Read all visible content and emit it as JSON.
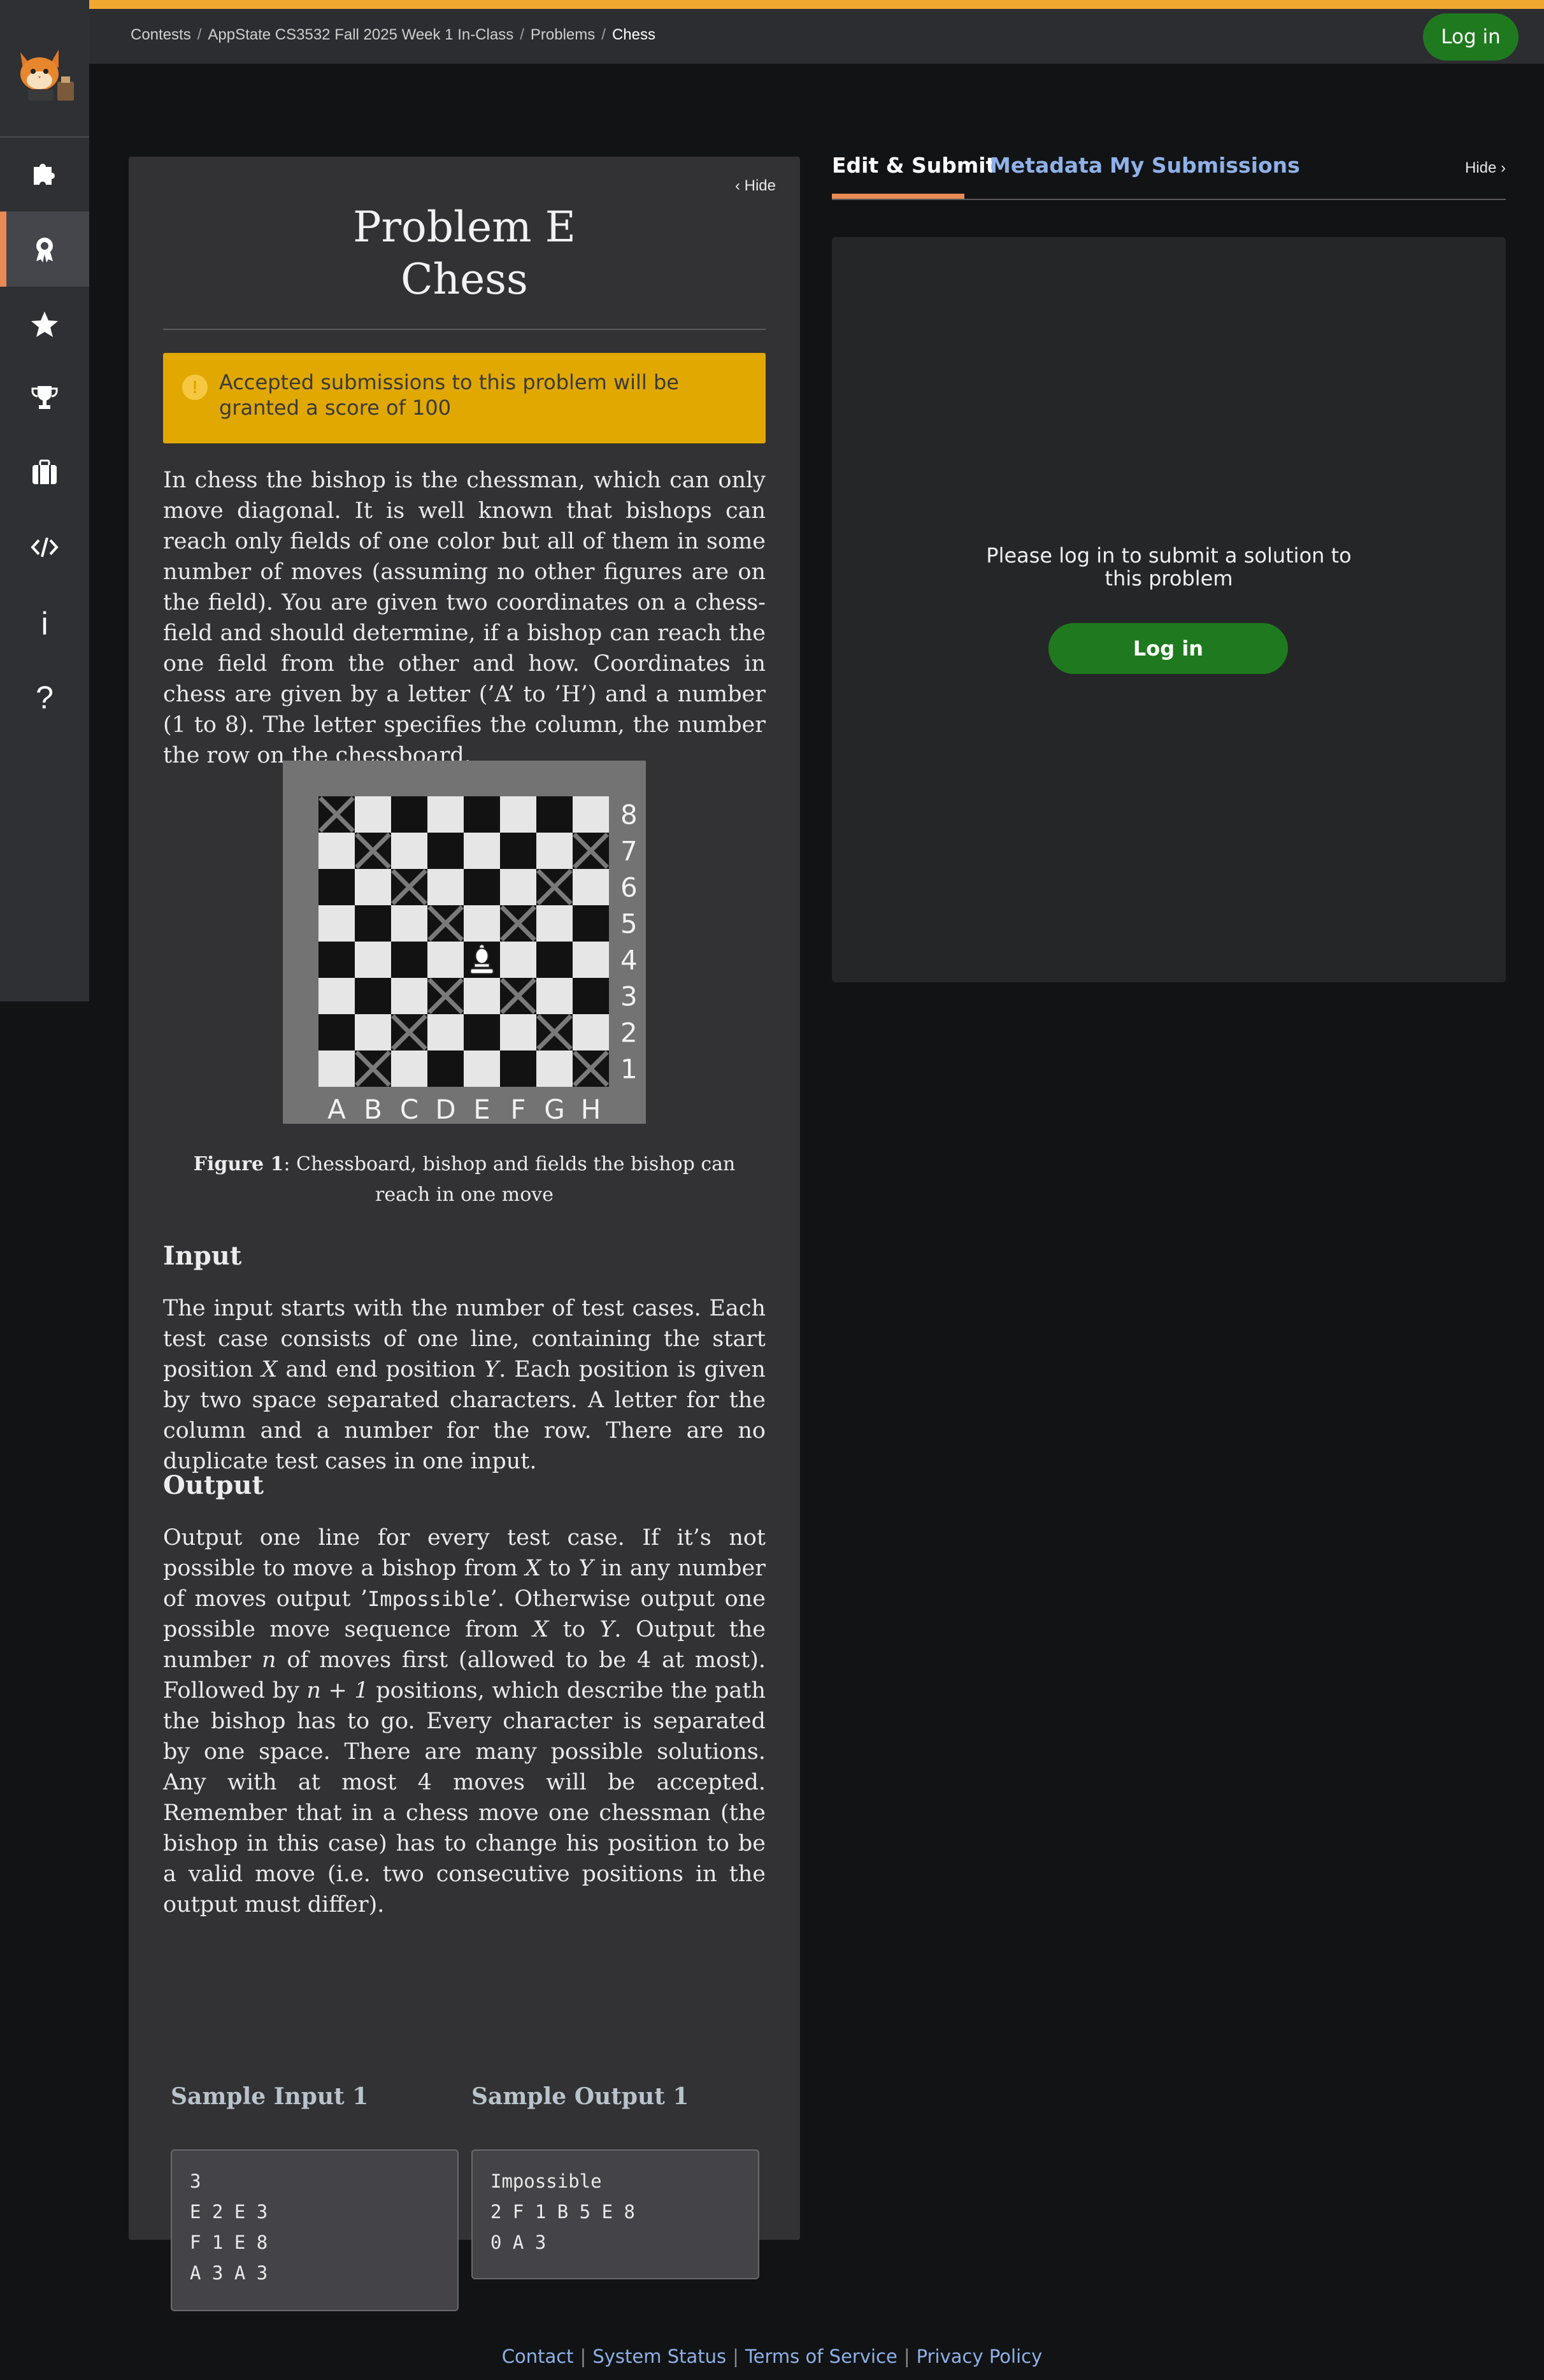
{
  "breadcrumb": {
    "items": [
      "Contests",
      "AppState CS3532 Fall 2025 Week 1 In-Class",
      "Problems"
    ],
    "current": "Chess"
  },
  "header": {
    "login_label": "Log in"
  },
  "sidebar": {
    "items": [
      {
        "icon": "puzzle-icon"
      },
      {
        "icon": "award-icon",
        "active": true
      },
      {
        "icon": "star-icon"
      },
      {
        "icon": "trophy-icon"
      },
      {
        "icon": "briefcase-icon"
      },
      {
        "icon": "code-icon"
      },
      {
        "icon": "info-icon",
        "label": "i"
      },
      {
        "icon": "help-icon",
        "label": "?"
      }
    ]
  },
  "problem": {
    "hide_label": "Hide",
    "title_line1": "Problem E",
    "title_line2": "Chess",
    "alert": "Accepted submissions to this problem will be granted a score of 100",
    "intro": "In chess the bishop is the chessman, which can only move diagonal. It is well known that bishops can reach only fields of one color but all of them in some number of moves (assuming no other figures are on the field). You are given two coordinates on a chess-field and should determine, if a bishop can reach the one field from the other and how. Coordinates in chess are given by a letter (’A’ to ’H’) and a number (1 to 8). The letter specifies the column, the number the row on the chessboard.",
    "figure": {
      "files": [
        "A",
        "B",
        "C",
        "D",
        "E",
        "F",
        "G",
        "H"
      ],
      "ranks": [
        "8",
        "7",
        "6",
        "5",
        "4",
        "3",
        "2",
        "1"
      ],
      "bishop": "E4",
      "marked": [
        "A8",
        "B7",
        "H7",
        "C6",
        "G6",
        "D5",
        "F5",
        "D3",
        "F3",
        "C2",
        "G2",
        "B1",
        "H1"
      ],
      "caption_label": "Figure 1",
      "caption_text": ": Chessboard, bishop and fields the bishop can reach in one move"
    },
    "input_heading": "Input",
    "input_parts": {
      "a": "The input starts with the number of test cases. Each test case consists of one line, containing the start position ",
      "var_x": "X",
      "b": " and end position ",
      "var_y": "Y",
      "c": ". Each position is given by two space separated characters. A letter for the column and a number for the row. There are no duplicate test cases in one input."
    },
    "output_heading": "Output",
    "output_parts": {
      "a": "Output one line for every test case. If it’s not possible to move a bishop from ",
      "x1": "X",
      "b": " to ",
      "y1": "Y",
      "c": " in any number of moves output ’",
      "impossible": "Impossible",
      "d": "’. Otherwise output one possible move sequence from ",
      "x2": "X",
      "e": " to ",
      "y2": "Y",
      "f": ". Output the number ",
      "n": "n",
      "g": " of moves first (allowed to be 4 at most). Followed by ",
      "n1": "n + 1",
      "h": " positions, which describe the path the bishop has to go. Every character is separated by one space. There are many possible solutions. Any with at most 4 moves will be accepted. Remember that in a chess move one chessman (the bishop in this case) has to change his position to be a valid move (i.e. two consecutive positions in the output must differ)."
    },
    "sample_input_heading": "Sample Input 1",
    "sample_output_heading": "Sample Output 1",
    "sample_input": [
      "3",
      "E 2 E 3",
      "F 1 E 8",
      "A 3 A 3"
    ],
    "sample_output": [
      "Impossible",
      "2 F 1 B 5 E 8",
      "0 A 3"
    ]
  },
  "submit": {
    "tabs": [
      "Edit & Submit",
      "Metadata",
      "My Submissions"
    ],
    "hide_label": "Hide",
    "message_line1": "Please log in to submit a solution to",
    "message_line2": "this problem",
    "login_label": "Log in"
  },
  "footer": {
    "links": [
      "Contact",
      "System Status",
      "Terms of Service",
      "Privacy Policy"
    ]
  },
  "colors": {
    "accent": "#f0a830",
    "active_tab": "#e98a55",
    "login_green": "#1f7a1f",
    "alert_yellow": "#e0a800",
    "link_blue": "#8fb1e8"
  }
}
